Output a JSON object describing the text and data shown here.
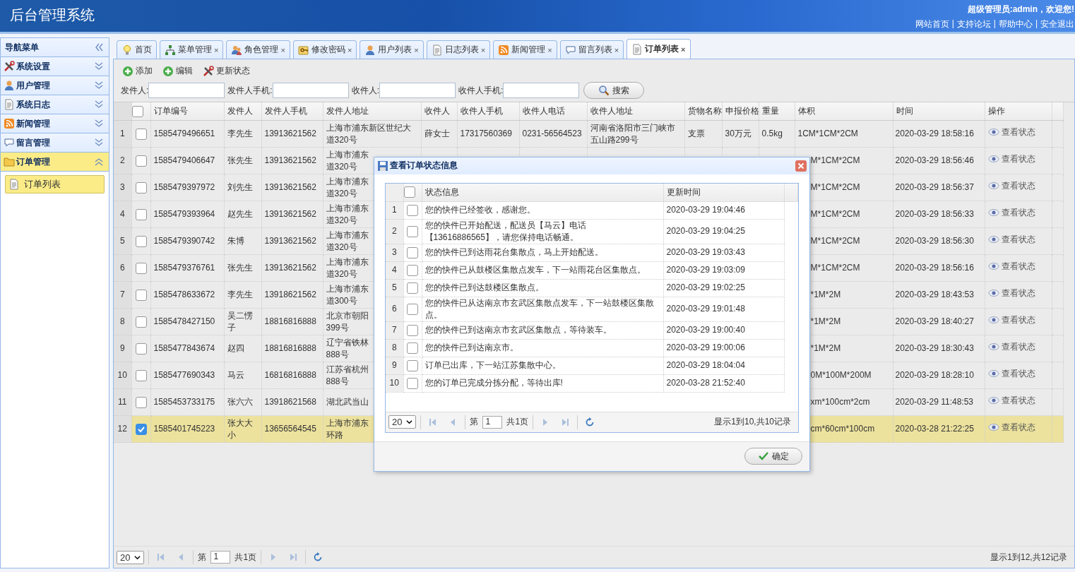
{
  "header": {
    "title": "后台管理系统",
    "greeting": "超级管理员:admin，欢迎您!",
    "links": [
      {
        "label": "网站首页",
        "separator": "|"
      },
      {
        "label": "支持论坛",
        "separator": "|"
      },
      {
        "label": "帮助中心",
        "separator": "|"
      },
      {
        "label": "安全退出"
      }
    ]
  },
  "sidebar": {
    "title": "导航菜单",
    "sections": [
      {
        "label": "系统设置",
        "expanded": false
      },
      {
        "label": "用户管理",
        "expanded": false
      },
      {
        "label": "系统日志",
        "expanded": false
      },
      {
        "label": "新闻管理",
        "expanded": false
      },
      {
        "label": "留言管理",
        "expanded": false
      },
      {
        "label": "订单管理",
        "expanded": true,
        "children": [
          {
            "label": "订单列表",
            "selected": true
          }
        ]
      }
    ]
  },
  "tabs": [
    {
      "label": "首页",
      "selected": false
    },
    {
      "label": "菜单管理",
      "selected": false,
      "close": "×"
    },
    {
      "label": "角色管理",
      "selected": false,
      "close": "×"
    },
    {
      "label": "修改密码",
      "selected": false,
      "close": "×"
    },
    {
      "label": "用户列表",
      "selected": false,
      "close": "×"
    },
    {
      "label": "日志列表",
      "selected": false,
      "close": "×"
    },
    {
      "label": "新闻管理",
      "selected": false,
      "close": "×"
    },
    {
      "label": "留言列表",
      "selected": false,
      "close": "×"
    },
    {
      "label": "订单列表",
      "selected": true,
      "close": "×"
    }
  ],
  "toolbar": [
    {
      "label": "添加"
    },
    {
      "label": "编辑"
    },
    {
      "label": "更新状态"
    }
  ],
  "search": {
    "fields": [
      {
        "label": "发件人:"
      },
      {
        "label": "发件人手机:"
      },
      {
        "label": "收件人:"
      },
      {
        "label": "收件人手机:"
      }
    ],
    "button": "搜索"
  },
  "table": {
    "header_checked": false,
    "columns": [
      "订单编号",
      "发件人",
      "发件人手机",
      "发件人地址",
      "收件人",
      "收件人手机",
      "收件人电话",
      "收件人地址",
      "货物名称",
      "申报价格",
      "重量",
      "体积",
      "时间",
      "操作"
    ],
    "rows": [
      {
        "num": "1",
        "checked": false,
        "selected": false,
        "order_no": "1585479496651",
        "sender": "李先生",
        "sender_phone": "13913621562",
        "sender_address": [
          "上海市浦东新区世纪大",
          "道320号"
        ],
        "receiver": "薛女士",
        "receiver_mobile": "17317560369",
        "receiver_phone": "0231-56564523",
        "receiver_address": "河南省洛阳市三门峡市五山路299号",
        "goods": "支票",
        "price": "30万元",
        "weight": "0.5kg",
        "volume": "1CM*1CM*2CM",
        "time": "2020-03-29 18:58:16",
        "action": "查看状态"
      },
      {
        "num": "2",
        "checked": false,
        "selected": false,
        "order_no": "1585479406647",
        "sender": "张先生",
        "sender_phone": "13913621562",
        "sender_address": [
          "上海市浦东",
          "道320号"
        ],
        "volume": "M*1CM*2CM",
        "time": "2020-03-29 18:56:46",
        "action": "查看状态"
      },
      {
        "num": "3",
        "checked": false,
        "selected": false,
        "order_no": "1585479397972",
        "sender": "刘先生",
        "sender_phone": "13913621562",
        "sender_address": [
          "上海市浦东",
          "道320号"
        ],
        "volume": "M*1CM*2CM",
        "time": "2020-03-29 18:56:37",
        "action": "查看状态"
      },
      {
        "num": "4",
        "checked": false,
        "selected": false,
        "order_no": "1585479393964",
        "sender": "赵先生",
        "sender_phone": "13913621562",
        "sender_address": [
          "上海市浦东",
          "道320号"
        ],
        "volume": "M*1CM*2CM",
        "time": "2020-03-29 18:56:33",
        "action": "查看状态"
      },
      {
        "num": "5",
        "checked": false,
        "selected": false,
        "order_no": "1585479390742",
        "sender": "朱博",
        "sender_phone": "13913621562",
        "sender_address": [
          "上海市浦东",
          "道320号"
        ],
        "volume": "M*1CM*2CM",
        "time": "2020-03-29 18:56:30",
        "action": "查看状态"
      },
      {
        "num": "6",
        "checked": false,
        "selected": false,
        "order_no": "1585479376761",
        "sender": "张先生",
        "sender_phone": "13913621562",
        "sender_address": [
          "上海市浦东",
          "道320号"
        ],
        "volume": "M*1CM*2CM",
        "time": "2020-03-29 18:56:16",
        "action": "查看状态"
      },
      {
        "num": "7",
        "checked": false,
        "selected": false,
        "order_no": "1585478633672",
        "sender": "李先生",
        "sender_phone": "13918621562",
        "sender_address": [
          "上海市浦东",
          "道300号"
        ],
        "volume": "*1M*2M",
        "time": "2020-03-29 18:43:53",
        "action": "查看状态"
      },
      {
        "num": "8",
        "checked": false,
        "selected": false,
        "order_no": "1585478427150",
        "sender": "吴二愣子",
        "sender_phone": "18816816888",
        "sender_address": [
          "北京市朝阳",
          "399号"
        ],
        "volume": "*1M*2M",
        "time": "2020-03-29 18:40:27",
        "action": "查看状态"
      },
      {
        "num": "9",
        "checked": false,
        "selected": false,
        "order_no": "1585477843674",
        "sender": "赵四",
        "sender_phone": "18816816888",
        "sender_address": [
          "辽宁省铁林",
          "888号"
        ],
        "volume": "*1M*2M",
        "time": "2020-03-29 18:30:43",
        "action": "查看状态"
      },
      {
        "num": "10",
        "checked": false,
        "selected": false,
        "order_no": "1585477690343",
        "sender": "马云",
        "sender_phone": "16816816888",
        "sender_address": [
          "江苏省杭州",
          "888号"
        ],
        "volume": "0M*100M*200M",
        "time": "2020-03-29 18:28:10",
        "action": "查看状态"
      },
      {
        "num": "11",
        "checked": false,
        "selected": false,
        "order_no": "1585453733175",
        "sender": "张六六",
        "sender_phone": "13918621568",
        "sender_address": [
          "湖北武当山"
        ],
        "volume": "xm*100cm*2cm",
        "time": "2020-03-29 11:48:53",
        "action": "查看状态"
      },
      {
        "num": "12",
        "checked": true,
        "selected": true,
        "order_no": "1585401745223",
        "sender": "张大大小",
        "sender_phone": "13656564545",
        "sender_address": [
          "上海市浦东",
          "环路"
        ],
        "volume": "cm*60cm*100cm",
        "time": "2020-03-28 21:22:25",
        "action": "查看状态"
      }
    ],
    "pager": {
      "page_size": "20",
      "page_label": "第",
      "page": "1",
      "total_pages": "共1页",
      "summary": "显示1到12,共12记录"
    }
  },
  "dialog": {
    "title": "查看订单状态信息",
    "header_checked": false,
    "columns": [
      "状态信息",
      "更新时间"
    ],
    "rows": [
      {
        "num": "1",
        "checked": false,
        "status": "您的快件已经签收，感谢您。",
        "time": "2020-03-29 19:04:46"
      },
      {
        "num": "2",
        "checked": false,
        "status": "您的快件已开始配送，配送员【马云】电话【13616886565】，请您保持电话畅通。",
        "time": "2020-03-29 19:04:25"
      },
      {
        "num": "3",
        "checked": false,
        "status": "您的快件已到达雨花台集散点，马上开始配送。",
        "time": "2020-03-29 19:03:43"
      },
      {
        "num": "4",
        "checked": false,
        "status": "您的快件已从鼓楼区集散点发车，下一站雨花台区集散点。",
        "time": "2020-03-29 19:03:09"
      },
      {
        "num": "5",
        "checked": false,
        "status": "您的快件已到达鼓楼区集散点。",
        "time": "2020-03-29 19:02:25"
      },
      {
        "num": "6",
        "checked": false,
        "status": "您的快件已从达南京市玄武区集散点发车，下一站鼓楼区集散点。",
        "time": "2020-03-29 19:01:48"
      },
      {
        "num": "7",
        "checked": false,
        "status": "您的快件已到达南京市玄武区集散点，等待装车。",
        "time": "2020-03-29 19:00:40"
      },
      {
        "num": "8",
        "checked": false,
        "status": "您的快件已到达南京市。",
        "time": "2020-03-29 19:00:06"
      },
      {
        "num": "9",
        "checked": false,
        "status": "订单已出库，下一站江苏集散中心。",
        "time": "2020-03-29 18:04:04"
      },
      {
        "num": "10",
        "checked": false,
        "status": "您的订单已完成分拣分配，等待出库!",
        "time": "2020-03-28 21:52:40"
      }
    ],
    "pager": {
      "page_size": "20",
      "page_label": "第",
      "page": "1",
      "total_pages": "共1页",
      "summary": "显示1到10,共10记录"
    },
    "ok_button": "确定"
  }
}
